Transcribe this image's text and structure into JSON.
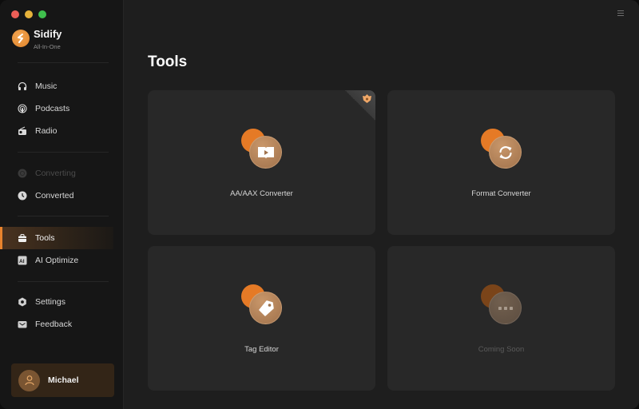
{
  "window": {
    "traffic_lights": [
      {
        "name": "close",
        "color": "#ec5f57"
      },
      {
        "name": "minimize",
        "color": "#e6b23a"
      },
      {
        "name": "maximize",
        "color": "#3fbf4d"
      }
    ]
  },
  "brand": {
    "name": "Sidify",
    "tagline": "All-In-One",
    "accent": "#e8832d"
  },
  "sidebar": {
    "items": [
      {
        "label": "Music",
        "icon": "headphones-icon",
        "state": "normal"
      },
      {
        "label": "Podcasts",
        "icon": "podcast-icon",
        "state": "normal"
      },
      {
        "label": "Radio",
        "icon": "radio-icon",
        "state": "normal"
      },
      {
        "label": "Converting",
        "icon": "converting-icon",
        "state": "disabled"
      },
      {
        "label": "Converted",
        "icon": "clock-icon",
        "state": "normal"
      },
      {
        "label": "Tools",
        "icon": "toolbox-icon",
        "state": "active"
      },
      {
        "label": "AI Optimize",
        "icon": "ai-icon",
        "state": "normal"
      },
      {
        "label": "Settings",
        "icon": "gear-icon",
        "state": "normal"
      },
      {
        "label": "Feedback",
        "icon": "mail-icon",
        "state": "normal"
      }
    ],
    "user": {
      "name": "Michael"
    }
  },
  "main": {
    "title": "Tools",
    "tools": [
      {
        "label": "AA/AAX Converter",
        "icon": "audiobook-icon",
        "badge": "premium-crown-icon",
        "enabled": true
      },
      {
        "label": "Format Converter",
        "icon": "refresh-icon",
        "enabled": true
      },
      {
        "label": "Tag Editor",
        "icon": "tag-icon",
        "enabled": true
      },
      {
        "label": "Coming Soon",
        "icon": "more-icon",
        "enabled": false
      }
    ]
  }
}
